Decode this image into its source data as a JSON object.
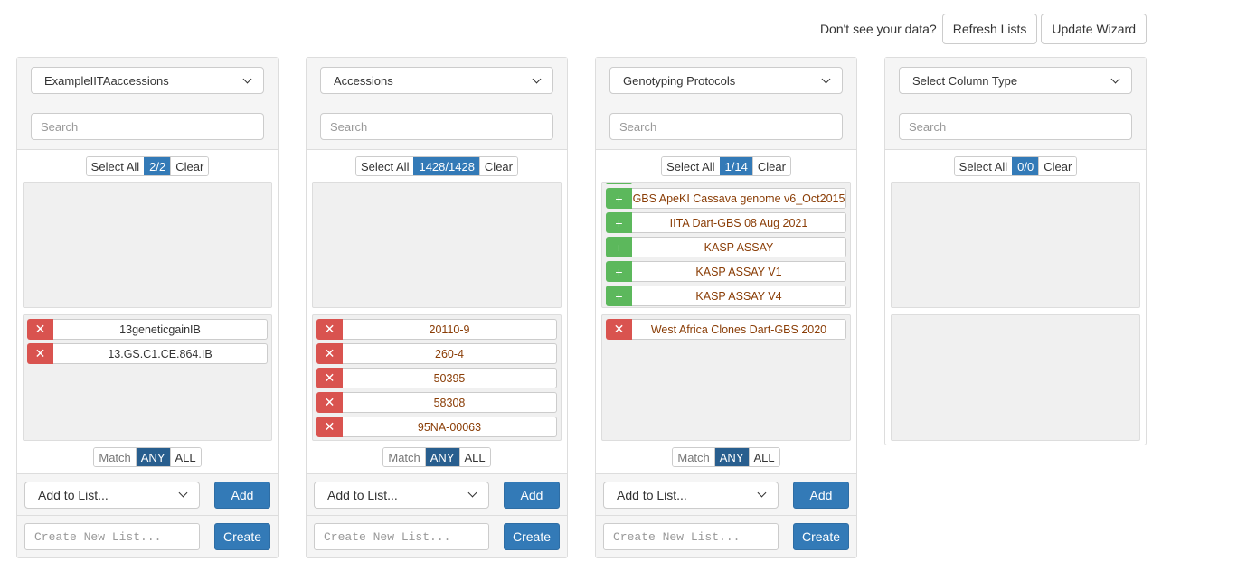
{
  "topbar": {
    "question": "Don't see your data?",
    "refresh_label": "Refresh Lists",
    "update_label": "Update Wizard"
  },
  "common": {
    "search_placeholder": "Search",
    "select_all": "Select All",
    "clear": "Clear",
    "match": "Match",
    "any": "ANY",
    "all": "ALL",
    "add_to_list": "Add to List...",
    "add": "Add",
    "create_placeholder": "Create New List...",
    "create": "Create"
  },
  "panels": [
    {
      "type": "ExampleIITAaccessions",
      "count": "2/2",
      "available": [],
      "selected": [
        "13geneticgainIB",
        "13.GS.C1.CE.864.IB"
      ]
    },
    {
      "type": "Accessions",
      "count": "1428/1428",
      "available": [],
      "selected": [
        "20110-9",
        "260-4",
        "50395",
        "58308",
        "95NA-00063"
      ]
    },
    {
      "type": "Genotyping Protocols",
      "count": "1/14",
      "available": [
        "GBS ApeKI Cassava genome v6_Oct2015",
        "IITA Dart-GBS 08 Aug 2021",
        "KASP ASSAY",
        "KASP ASSAY V1",
        "KASP ASSAY V4"
      ],
      "selected": [
        "West Africa Clones Dart-GBS 2020"
      ]
    },
    {
      "type": "Select Column Type",
      "count": "0/0",
      "available": [],
      "selected": []
    }
  ],
  "colors": {
    "primary": "#337ab7",
    "danger": "#d9534f",
    "success": "#5cb85c",
    "item_text": "#8a3d06"
  },
  "icons": {
    "remove": "close-icon",
    "add": "plus-icon",
    "dropdown": "chevron-down-icon"
  }
}
